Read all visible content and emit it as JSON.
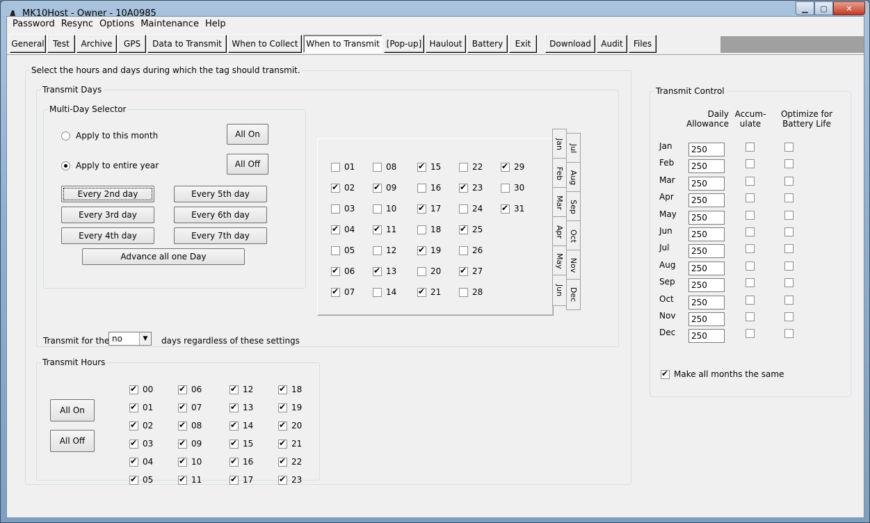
{
  "window": {
    "title": "MK10Host - Owner - 10A0985"
  },
  "menu": [
    "Password",
    "Resync",
    "Options",
    "Maintenance",
    "Help"
  ],
  "tabs": [
    "General",
    "Test",
    "Archive",
    "GPS",
    "Data to Transmit",
    "When to Collect",
    "When to Transmit",
    "[Pop-up]",
    "Haulout",
    "Battery",
    "Exit",
    "Download",
    "Audit",
    "Files"
  ],
  "selected_tab": "When to Transmit",
  "main": {
    "instruction": "Select the hours and days during which the tag should transmit.",
    "transmit_days": {
      "legend": "Transmit Days",
      "multi_day": {
        "legend": "Multi-Day Selector",
        "radio_month": "Apply to this month",
        "radio_year": "Apply to entire year",
        "selected": "year",
        "all_on": "All On",
        "all_off": "All Off",
        "every": [
          "Every 2nd day",
          "Every 5th day",
          "Every 3rd day",
          "Every 6th day",
          "Every 4th day",
          "Every 7th day"
        ],
        "advance": "Advance all one Day"
      },
      "days": [
        {
          "label": "01",
          "checked": false
        },
        {
          "label": "02",
          "checked": true
        },
        {
          "label": "03",
          "checked": false
        },
        {
          "label": "04",
          "checked": true
        },
        {
          "label": "05",
          "checked": false
        },
        {
          "label": "06",
          "checked": true
        },
        {
          "label": "07",
          "checked": true
        },
        {
          "label": "08",
          "checked": false
        },
        {
          "label": "09",
          "checked": true
        },
        {
          "label": "10",
          "checked": false
        },
        {
          "label": "11",
          "checked": true
        },
        {
          "label": "12",
          "checked": false
        },
        {
          "label": "13",
          "checked": true
        },
        {
          "label": "14",
          "checked": false
        },
        {
          "label": "15",
          "checked": true
        },
        {
          "label": "16",
          "checked": false
        },
        {
          "label": "17",
          "checked": true
        },
        {
          "label": "18",
          "checked": false
        },
        {
          "label": "19",
          "checked": true
        },
        {
          "label": "20",
          "checked": false
        },
        {
          "label": "21",
          "checked": true
        },
        {
          "label": "22",
          "checked": false
        },
        {
          "label": "23",
          "checked": true
        },
        {
          "label": "24",
          "checked": false
        },
        {
          "label": "25",
          "checked": true
        },
        {
          "label": "26",
          "checked": false
        },
        {
          "label": "27",
          "checked": true
        },
        {
          "label": "28",
          "checked": false
        },
        {
          "label": "29",
          "checked": true
        },
        {
          "label": "30",
          "checked": false
        },
        {
          "label": "31",
          "checked": true
        }
      ],
      "month_tabs": [
        "Jan",
        "Jul",
        "Feb",
        "Aug",
        "Mar",
        "Sep",
        "Apr",
        "Oct",
        "May",
        "Nov",
        "Jun",
        "Dec"
      ],
      "first_days_prefix": "Transmit for the first",
      "first_days_value": "no",
      "first_days_suffix": "days regardless of these settings"
    },
    "transmit_hours": {
      "legend": "Transmit Hours",
      "all_on": "All On",
      "all_off": "All Off",
      "hours": [
        "00",
        "01",
        "02",
        "03",
        "04",
        "05",
        "06",
        "07",
        "08",
        "09",
        "10",
        "11",
        "12",
        "13",
        "14",
        "15",
        "16",
        "17",
        "18",
        "19",
        "20",
        "21",
        "22",
        "23"
      ],
      "all_checked": true
    }
  },
  "transmit_control": {
    "legend": "Transmit Control",
    "col_allowance": "Daily Allowance",
    "col_accumulate": "Accum- ulate",
    "col_optimize": "Optimize for Battery Life",
    "months": [
      {
        "name": "Jan",
        "value": "250"
      },
      {
        "name": "Feb",
        "value": "250"
      },
      {
        "name": "Mar",
        "value": "250"
      },
      {
        "name": "Apr",
        "value": "250"
      },
      {
        "name": "May",
        "value": "250"
      },
      {
        "name": "Jun",
        "value": "250"
      },
      {
        "name": "Jul",
        "value": "250"
      },
      {
        "name": "Aug",
        "value": "250"
      },
      {
        "name": "Sep",
        "value": "250"
      },
      {
        "name": "Oct",
        "value": "250"
      },
      {
        "name": "Nov",
        "value": "250"
      },
      {
        "name": "Dec",
        "value": "250"
      }
    ],
    "same_label": "Make all months the same",
    "same_checked": true
  }
}
